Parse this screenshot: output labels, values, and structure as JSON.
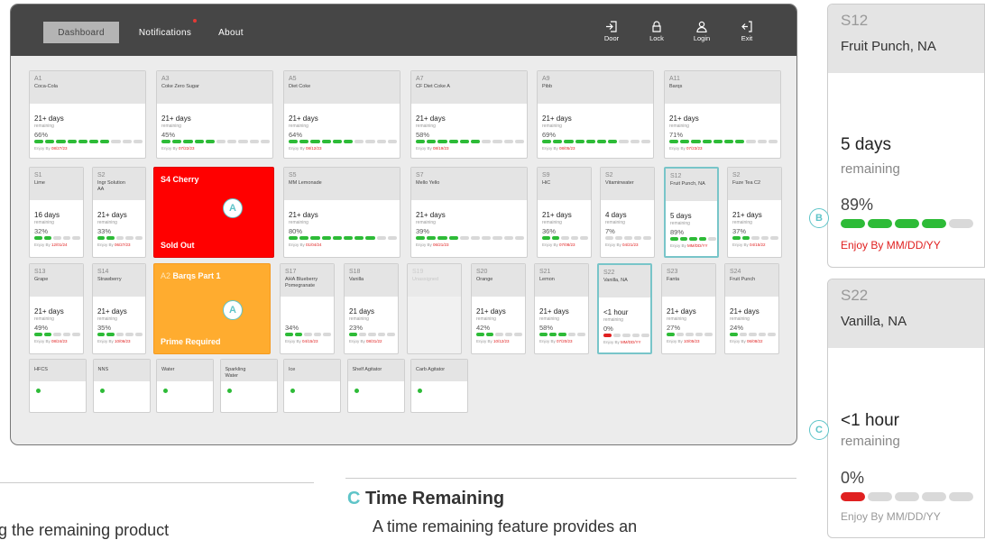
{
  "nav": {
    "dashboard": "Dashboard",
    "notifications": "Notifications",
    "about": "About"
  },
  "toolbar": {
    "door": "Door",
    "lock": "Lock",
    "login": "Login",
    "exit": "Exit"
  },
  "row1": [
    {
      "slot": "A1",
      "name": "Coca-Cola",
      "time": "21+ days",
      "remaining": "remaining",
      "pct": "66%",
      "level": 0.66,
      "enjoy_prefix": "Enjoy By ",
      "enjoy": "08/27/23"
    },
    {
      "slot": "A3",
      "name": "Coke Zero Sugar",
      "time": "21+ days",
      "remaining": "remaining",
      "pct": "45%",
      "level": 0.45,
      "enjoy_prefix": "Enjoy By ",
      "enjoy": "07/22/23"
    },
    {
      "slot": "A5",
      "name": "Diet Coke",
      "time": "21+ days",
      "remaining": "remaining",
      "pct": "64%",
      "level": 0.64,
      "enjoy_prefix": "Enjoy By ",
      "enjoy": "08/12/23"
    },
    {
      "slot": "A7",
      "name": "CF Diet Coke A",
      "time": "21+ days",
      "remaining": "remaining",
      "pct": "58%",
      "level": 0.58,
      "enjoy_prefix": "Enjoy By ",
      "enjoy": "08/19/23"
    },
    {
      "slot": "A9",
      "name": "Pibb",
      "time": "21+ days",
      "remaining": "remaining",
      "pct": "69%",
      "level": 0.69,
      "enjoy_prefix": "Enjoy By ",
      "enjoy": "08/05/23"
    },
    {
      "slot": "A11",
      "name": "Barqs",
      "time": "21+ days",
      "remaining": "remaining",
      "pct": "71%",
      "level": 0.71,
      "enjoy_prefix": "Enjoy By ",
      "enjoy": "07/23/23"
    }
  ],
  "row2": [
    {
      "slot": "S1",
      "name": "Lime",
      "time": "16 days",
      "remaining": "remaining",
      "pct": "32%",
      "level": 0.32,
      "enjoy_prefix": "Enjoy By ",
      "enjoy": "12/01/24"
    },
    {
      "slot": "S2",
      "name": "Ingr Solution\nAA",
      "time": "21+ days",
      "remaining": "remaining",
      "pct": "33%",
      "level": 0.33,
      "enjoy_prefix": "Enjoy By ",
      "enjoy": "06/27/23"
    },
    {
      "slot": "S5",
      "name": "MM Lemonade",
      "time": "21+ days",
      "remaining": "remaining",
      "pct": "80%",
      "level": 0.8,
      "enjoy_prefix": "Enjoy By ",
      "enjoy": "01/04/24"
    },
    {
      "slot": "S7",
      "name": "Mello Yello",
      "time": "21+ days",
      "remaining": "remaining",
      "pct": "39%",
      "level": 0.39,
      "enjoy_prefix": "Enjoy By ",
      "enjoy": "06/21/23"
    },
    {
      "slot": "S9",
      "name": "HiC",
      "time": "21+ days",
      "remaining": "remaining",
      "pct": "36%",
      "level": 0.36,
      "enjoy_prefix": "Enjoy By ",
      "enjoy": "07/08/23"
    },
    {
      "slot": "S2",
      "name": "Vitaminwater",
      "time": "4 days",
      "remaining": "remaining",
      "pct": "7%",
      "level": 0.07,
      "enjoy_prefix": "Enjoy By ",
      "enjoy": "04/21/23"
    },
    {
      "slot": "S12",
      "name": "Fruit Punch, NA",
      "time": "5 days",
      "remaining": "remaining",
      "pct": "89%",
      "level": 0.89,
      "enjoy_prefix": "Enjoy By ",
      "enjoy": "MM/DD/YY"
    },
    {
      "slot": "S2",
      "name": "Fuze Tea C2",
      "time": "21+ days",
      "remaining": "remaining",
      "pct": "37%",
      "level": 0.37,
      "enjoy_prefix": "Enjoy By ",
      "enjoy": "04/15/22"
    }
  ],
  "cherry": {
    "slot": "S4",
    "name": "Cherry",
    "status": "Sold Out",
    "badge": "A"
  },
  "barqs": {
    "slot": "A2",
    "name": "Barqs Part 1",
    "status": "Prime Required",
    "badge": "A"
  },
  "row3": [
    {
      "slot": "S13",
      "name": "Grape",
      "time": "21+ days",
      "remaining": "remaining",
      "pct": "49%",
      "level": 0.49,
      "enjoy_prefix": "Enjoy By ",
      "enjoy": "08/24/23"
    },
    {
      "slot": "S14",
      "name": "Strawberry",
      "time": "21+ days",
      "remaining": "remaining",
      "pct": "35%",
      "level": 0.35,
      "enjoy_prefix": "Enjoy By ",
      "enjoy": "10/06/23"
    },
    {
      "slot": "S17",
      "name": "AHA Blueberry\nPomegranate",
      "time": "",
      "remaining": "",
      "pct": "34%",
      "level": 0.34,
      "enjoy_prefix": "Enjoy By ",
      "enjoy": "04/15/23"
    },
    {
      "slot": "S18",
      "name": "Vanilla",
      "time": "21 days",
      "remaining": "remaining",
      "pct": "23%",
      "level": 0.23,
      "enjoy_prefix": "Enjoy By ",
      "enjoy": "08/31/22"
    },
    {
      "slot": "S19",
      "name": "Unassigned",
      "unassigned": true
    },
    {
      "slot": "S20",
      "name": "Orange",
      "time": "21+ days",
      "remaining": "remaining",
      "pct": "42%",
      "level": 0.42,
      "enjoy_prefix": "Enjoy By ",
      "enjoy": "10/12/23"
    },
    {
      "slot": "S21",
      "name": "Lemon",
      "time": "21+ days",
      "remaining": "remaining",
      "pct": "58%",
      "level": 0.58,
      "enjoy_prefix": "Enjoy By ",
      "enjoy": "07/20/23"
    },
    {
      "slot": "S22",
      "name": "Vanilla, NA",
      "time": "<1 hour",
      "remaining": "remaining",
      "pct": "0%",
      "level": 0.0,
      "enjoy_prefix": "Enjoy By ",
      "enjoy": "MM/DD/YY"
    },
    {
      "slot": "S23",
      "name": "Fanta",
      "time": "21+ days",
      "remaining": "remaining",
      "pct": "27%",
      "level": 0.27,
      "enjoy_prefix": "Enjoy By ",
      "enjoy": "10/05/23"
    },
    {
      "slot": "S24",
      "name": "Fruit Punch",
      "time": "21+ days",
      "remaining": "remaining",
      "pct": "24%",
      "level": 0.24,
      "enjoy_prefix": "Enjoy By ",
      "enjoy": "06/08/22"
    }
  ],
  "row4": [
    "HFCS",
    "NNS",
    "Water",
    "Sparkling\nWater",
    "Ice",
    "Shelf Agitator",
    "Carb Agitator"
  ],
  "panel_b": {
    "slot": "S12",
    "name": "Fruit Punch, NA",
    "time": "5 days",
    "remaining": "remaining",
    "pct": "89%",
    "level": 0.89,
    "enjoy_prefix": "Enjoy By ",
    "enjoy": "MM/DD/YY",
    "badge": "B"
  },
  "panel_c": {
    "slot": "S22",
    "name": "Vanilla, NA",
    "time": "<1 hour",
    "remaining": "remaining",
    "pct": "0%",
    "level": 0.0,
    "enjoy_prefix": "Enjoy By ",
    "enjoy": "MM/DD/YY",
    "badge": "C"
  },
  "section_left": {
    "text": "g the remaining product"
  },
  "section_c": {
    "letter": "C",
    "title": "Time Remaining",
    "text": "A time remaining feature provides an"
  },
  "colors": {
    "green": "#2dbb37",
    "red": "#e02020",
    "orange": "#ffac2f",
    "teal": "#5ec4c8",
    "topbar": "#464646"
  }
}
